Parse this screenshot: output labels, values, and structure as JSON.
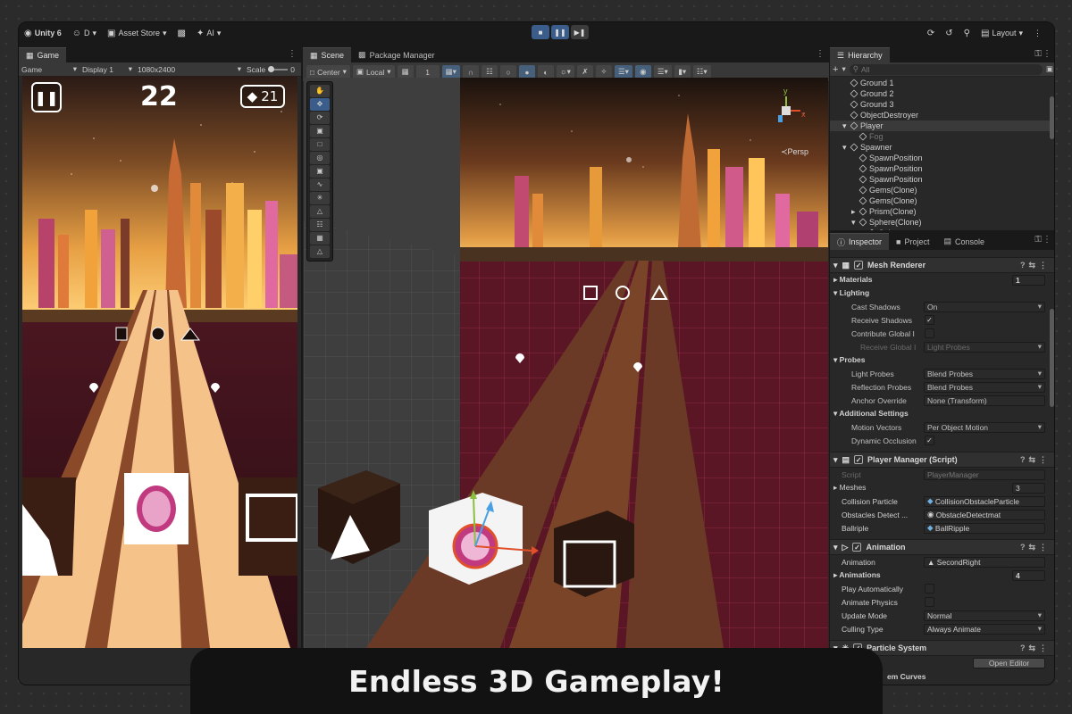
{
  "toolbar": {
    "app_name": "Unity 6",
    "account": "D",
    "asset_store": "Asset Store",
    "ai": "AI",
    "layout": "Layout"
  },
  "game_panel": {
    "tab": "Game",
    "mode": "Game",
    "display": "Display 1",
    "resolution": "1080x2400",
    "scale_label": "Scale",
    "scale_value_fragment": "0",
    "score": "22",
    "gems": "21"
  },
  "scene_panel": {
    "tab_scene": "Scene",
    "tab_package_manager": "Package Manager",
    "pivot": "Center",
    "space": "Local",
    "snap": "1",
    "persp": "Persp",
    "gizmo_y": "y",
    "gizmo_x": "x"
  },
  "hierarchy": {
    "tab": "Hierarchy",
    "search_placeholder": "All",
    "items": [
      {
        "label": "Ground 1",
        "indent": 1
      },
      {
        "label": "Ground 2",
        "indent": 1
      },
      {
        "label": "Ground 3",
        "indent": 1
      },
      {
        "label": "ObjectDestroyer",
        "indent": 1
      },
      {
        "label": "Player",
        "indent": 1,
        "expanded": true
      },
      {
        "label": "Fog",
        "indent": 2
      },
      {
        "label": "Spawner",
        "indent": 1,
        "expanded": true
      },
      {
        "label": "SpawnPosition",
        "indent": 2
      },
      {
        "label": "SpawnPosition",
        "indent": 2
      },
      {
        "label": "SpawnPosition",
        "indent": 2
      },
      {
        "label": "Gems(Clone)",
        "indent": 2
      },
      {
        "label": "Gems(Clone)",
        "indent": 2
      },
      {
        "label": "Prism(Clone)",
        "indent": 2,
        "collapsed": true
      },
      {
        "label": "Sphere(Clone)",
        "indent": 2,
        "expanded": true
      },
      {
        "label": "Cube",
        "indent": 3
      }
    ]
  },
  "inspector": {
    "tab_inspector": "Inspector",
    "tab_project": "Project",
    "tab_console": "Console",
    "mesh_renderer": {
      "title": "Mesh Renderer",
      "materials_label": "Materials",
      "materials_count": "1",
      "lighting": "Lighting",
      "cast_shadows_label": "Cast Shadows",
      "cast_shadows_value": "On",
      "receive_shadows_label": "Receive Shadows",
      "contribute_gi_label": "Contribute Global I",
      "receive_gi_label": "Receive Global I",
      "receive_gi_value": "Light Probes",
      "probes": "Probes",
      "light_probes_label": "Light Probes",
      "light_probes_value": "Blend Probes",
      "reflection_probes_label": "Reflection Probes",
      "reflection_probes_value": "Blend Probes",
      "anchor_override_label": "Anchor Override",
      "anchor_override_value": "None (Transform)",
      "additional_settings": "Additional Settings",
      "motion_vectors_label": "Motion Vectors",
      "motion_vectors_value": "Per Object Motion",
      "dynamic_occlusion_label": "Dynamic Occlusion"
    },
    "player_manager": {
      "title": "Player Manager (Script)",
      "script_label": "Script",
      "script_value": "PlayerManager",
      "meshes_label": "Meshes",
      "meshes_count": "3",
      "collision_label": "Collision Particle",
      "collision_value": "CollisionObstacleParticle",
      "obstacles_label": "Obstacles Detect ...",
      "obstacles_value": "ObstacleDetectmat",
      "ballriple_label": "Ballriple",
      "ballriple_value": "BallRipple"
    },
    "animation": {
      "title": "Animation",
      "animation_label": "Animation",
      "animation_value": "SecondRight",
      "animations_label": "Animations",
      "animations_count": "4",
      "play_auto_label": "Play Automatically",
      "animate_physics_label": "Animate Physics",
      "update_mode_label": "Update Mode",
      "update_mode_value": "Normal",
      "culling_label": "Culling Type",
      "culling_value": "Always Animate"
    },
    "particle_system": {
      "title": "Particle System",
      "open_editor": "Open Editor",
      "curves_fragment": "em Curves"
    }
  },
  "banner": "Endless 3D Gameplay!",
  "colors": {
    "accent_blue": "#3a5d8c",
    "editor_bg": "#282828",
    "sky_orange": "#e89a3c",
    "track_tan": "#f3c08a",
    "floor_maroon": "#5a1a22"
  }
}
